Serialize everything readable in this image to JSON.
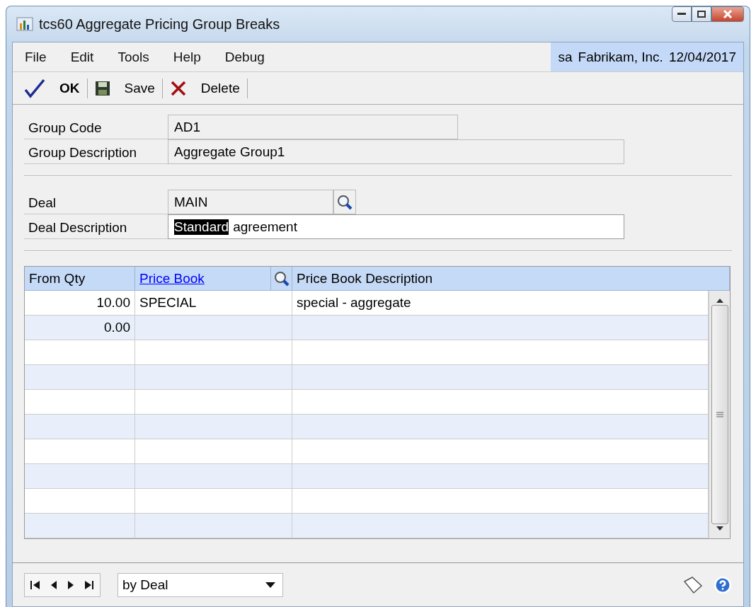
{
  "window": {
    "title": "tcs60 Aggregate Pricing Group Breaks"
  },
  "menu": [
    "File",
    "Edit",
    "Tools",
    "Help",
    "Debug"
  ],
  "session": {
    "user": "sa",
    "company": "Fabrikam, Inc.",
    "date": "12/04/2017"
  },
  "toolbar": [
    {
      "kind": "ok",
      "label": "OK"
    },
    {
      "kind": "save",
      "label": "Save"
    },
    {
      "kind": "delete",
      "label": "Delete"
    }
  ],
  "group": {
    "code_label": "Group Code",
    "code": "AD1",
    "description_label": "Group Description",
    "description": "Aggregate Group1"
  },
  "deal": {
    "label": "Deal",
    "value": "MAIN",
    "description_label": "Deal Description",
    "description_parts": [
      {
        "text": "Standard",
        "selected": true
      },
      {
        "text": "agreement",
        "selected": false
      }
    ]
  },
  "table": {
    "headers": [
      "From Qty",
      "Price Book",
      "Price Book Description"
    ],
    "rows": [
      {
        "from_qty": "10.00",
        "price_book": "SPECIAL",
        "description": "special - aggregate"
      },
      {
        "from_qty": "0.00"
      }
    ]
  },
  "footer": {
    "sort": "by Deal"
  }
}
